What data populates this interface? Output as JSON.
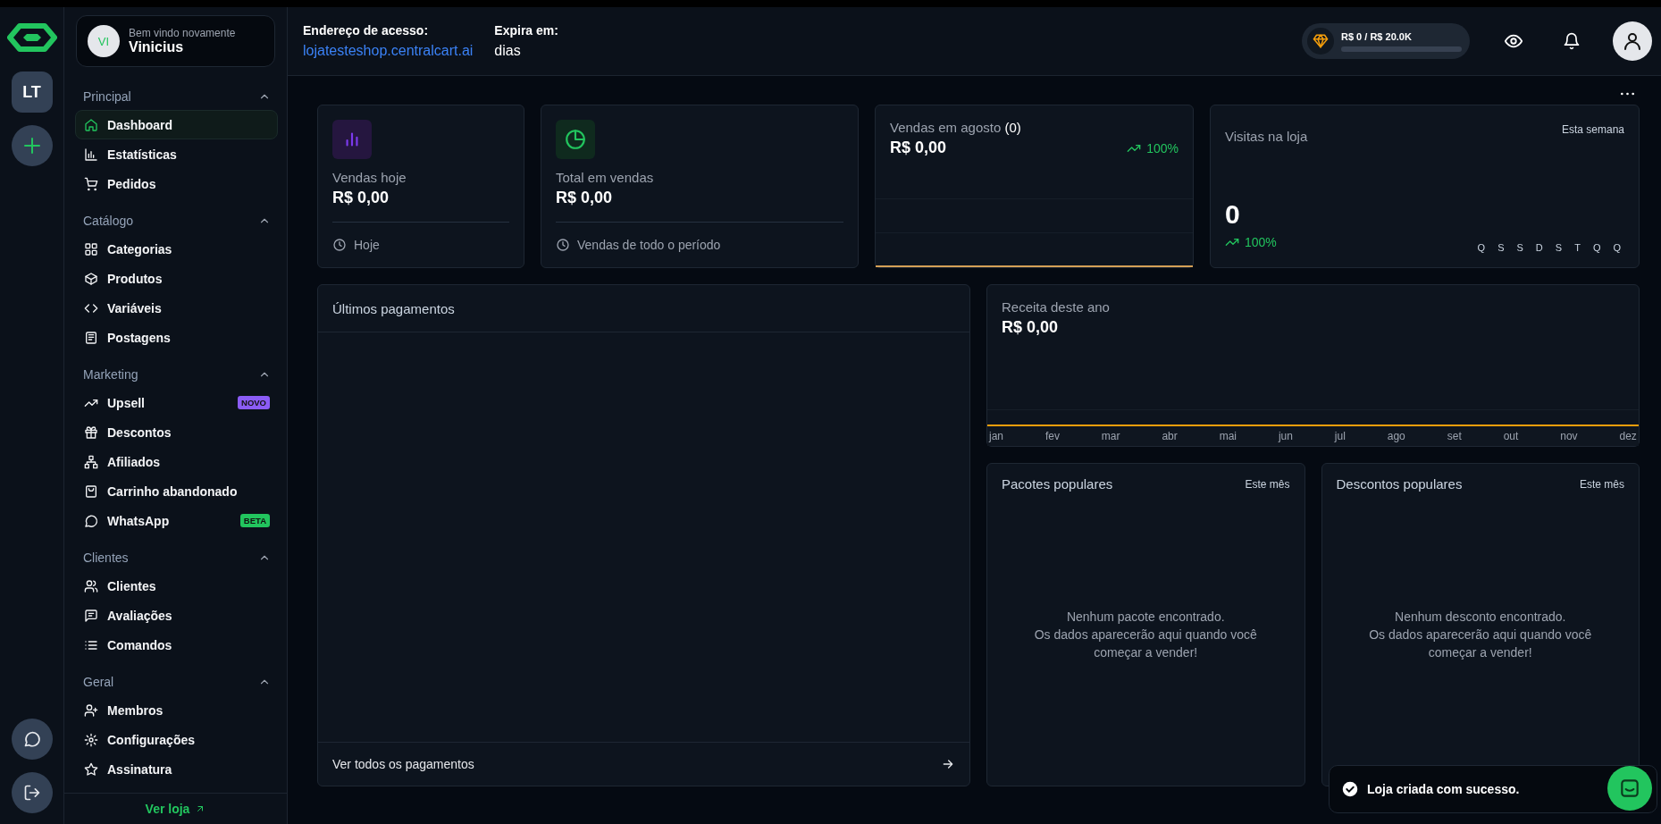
{
  "rail": {
    "workspace": "LT"
  },
  "welcome": {
    "avatar": "VI",
    "greeting": "Bem vindo novamente",
    "name": "Vinicius"
  },
  "sidebar": {
    "sections": [
      {
        "title": "Principal",
        "expanded": true,
        "items": [
          {
            "label": "Dashboard",
            "selected": true
          },
          {
            "label": "Estatísticas",
            "selected": false
          },
          {
            "label": "Pedidos",
            "selected": false
          }
        ]
      },
      {
        "title": "Catálogo",
        "expanded": true,
        "items": [
          {
            "label": "Categorias",
            "selected": false
          },
          {
            "label": "Produtos",
            "selected": false
          },
          {
            "label": "Variáveis",
            "selected": false
          },
          {
            "label": "Postagens",
            "selected": false
          }
        ]
      },
      {
        "title": "Marketing",
        "expanded": true,
        "items": [
          {
            "label": "Upsell",
            "selected": false,
            "badge": {
              "text": "NOVO",
              "color": "#8b5cf6"
            }
          },
          {
            "label": "Descontos",
            "selected": false
          },
          {
            "label": "Afiliados",
            "selected": false
          },
          {
            "label": "Carrinho abandonado",
            "selected": false
          },
          {
            "label": "WhatsApp",
            "selected": false,
            "badge": {
              "text": "BETA",
              "color": "#22c55e"
            }
          }
        ]
      },
      {
        "title": "Clientes",
        "expanded": true,
        "items": [
          {
            "label": "Clientes",
            "selected": false
          },
          {
            "label": "Avaliações",
            "selected": false
          },
          {
            "label": "Comandos",
            "selected": false
          }
        ]
      },
      {
        "title": "Geral",
        "expanded": true,
        "items": [
          {
            "label": "Membros",
            "selected": false
          },
          {
            "label": "Configurações",
            "selected": false
          },
          {
            "label": "Assinatura",
            "selected": false
          }
        ]
      }
    ],
    "footer_link": "Ver loja"
  },
  "header": {
    "access": {
      "label": "Endereço de acesso:",
      "url": "lojatesteshop.centralcart.ai"
    },
    "expiry": {
      "label": "Expira em:",
      "value": "dias"
    },
    "goal": {
      "text": "R$ 0 / R$ 20.0K",
      "level": 0
    }
  },
  "stats": [
    {
      "kind": "simple",
      "label": "Vendas hoje",
      "value": "R$ 0,00",
      "footer": "Hoje"
    },
    {
      "kind": "simple",
      "label": "Total em vendas",
      "value": "R$ 0,00",
      "footer": "Vendas de todo o período"
    },
    {
      "kind": "trend",
      "label": "Vendas em agosto **(0)**",
      "value": "R$ 0,00",
      "change": "100%"
    },
    {
      "kind": "visits",
      "label": "Visitas na loja",
      "period": "Esta semana",
      "value": "0",
      "change": "100%",
      "days": [
        "Q",
        "S",
        "S",
        "D",
        "S",
        "T",
        "Q",
        "Q"
      ]
    }
  ],
  "payments": {
    "title": "Últimos pagamentos",
    "link": "Ver todos os pagamentos"
  },
  "revenue": {
    "title": "Receita deste ano",
    "value": "R$ 0,00",
    "months": [
      "jan",
      "fev",
      "mar",
      "abr",
      "mai",
      "jun",
      "jul",
      "ago",
      "set",
      "out",
      "nov",
      "dez"
    ]
  },
  "popular": [
    {
      "title": "Pacotes populares",
      "period": "Este mês",
      "empty": "Nenhum pacote encontrado.",
      "hint": "Os dados aparecerão aqui quando você começar a vender!"
    },
    {
      "title": "Descontos populares",
      "period": "Este mês",
      "empty": "Nenhum desconto encontrado.",
      "hint": "Os dados aparecerão aqui quando você começar a vender!"
    }
  ],
  "toast": {
    "message": "Loja criada com sucesso."
  }
}
